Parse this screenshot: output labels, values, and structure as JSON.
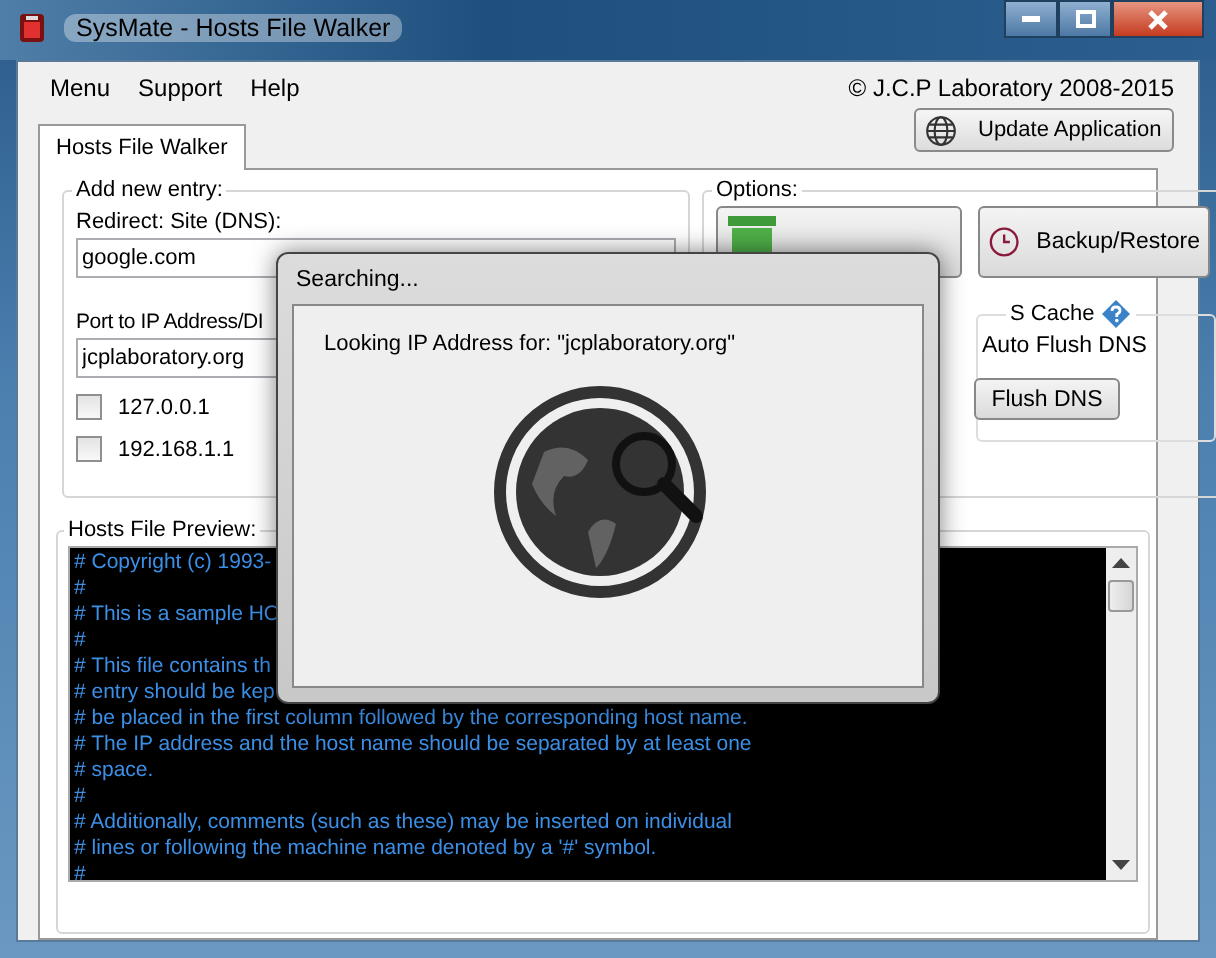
{
  "window": {
    "title": "SysMate - Hosts File Walker"
  },
  "menu": [
    "Menu",
    "Support",
    "Help"
  ],
  "copyright": "© J.C.P Laboratory 2008-2015",
  "update_button": "Update Application",
  "tabs": [
    {
      "label": "Hosts File Walker",
      "selected": true
    }
  ],
  "add_entry": {
    "legend": "Add new entry:",
    "redirect_label": "Redirect: Site (DNS):",
    "redirect_value": "google.com",
    "port_label": "Port to IP Address/DI",
    "port_value": "jcplaboratory.org",
    "options": [
      {
        "label": "127.0.0.1",
        "checked": false
      },
      {
        "label": "192.168.1.1",
        "checked": false
      }
    ]
  },
  "options": {
    "legend": "Options:",
    "backup_button": "Backup/Restore",
    "dns_cache": {
      "legend": "S Cache",
      "auto_flush_label": "Auto Flush DNS",
      "flush_button": "Flush DNS"
    }
  },
  "preview": {
    "legend": "Hosts File Preview:",
    "lines": [
      "# Copyright (c) 1993-",
      "#",
      "# This is a sample HO",
      "#",
      "# This file contains th",
      "# entry should be kep",
      "# be placed in the first column followed by the corresponding host name.",
      "# The IP address and the host name should be separated by at least one",
      "# space.",
      "#",
      "# Additionally, comments (such as these) may be inserted on individual",
      "# lines or following the machine name denoted by a '#' symbol.",
      "#"
    ]
  },
  "dialog": {
    "title": "Searching...",
    "message": "Looking IP Address for: \"jcplaboratory.org\""
  }
}
